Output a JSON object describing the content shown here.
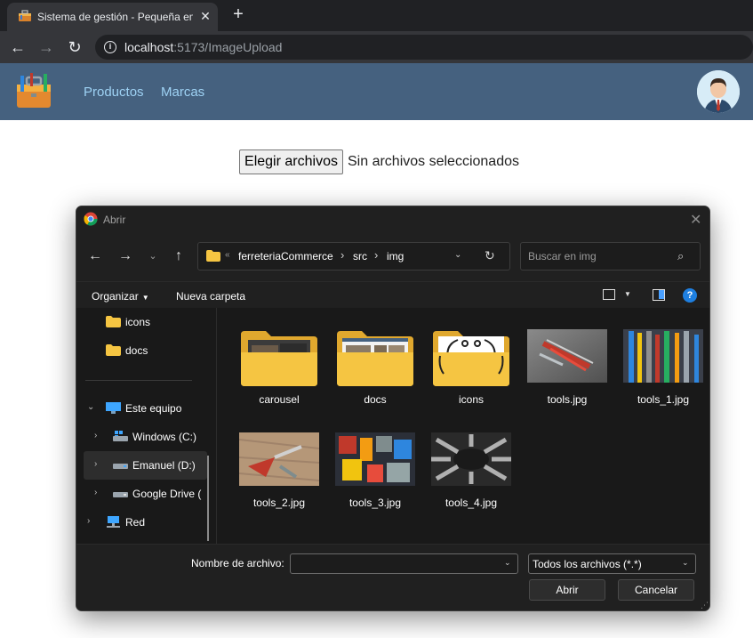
{
  "browser": {
    "tab_title": "Sistema de gestión - Pequeña empresa",
    "tab_close": "✕",
    "new_tab": "+",
    "url_host": "localhost",
    "url_path": ":5173/ImageUpload"
  },
  "app": {
    "nav": [
      {
        "label": "Productos"
      },
      {
        "label": "Marcas"
      }
    ]
  },
  "page": {
    "choose_button": "Elegir archivos",
    "no_files_text": "Sin archivos seleccionados"
  },
  "dialog": {
    "title": "Abrir",
    "close": "✕",
    "breadcrumb": [
      "ferreteriaCommerce",
      "src",
      "img"
    ],
    "breadcrumb_overflow": "«",
    "search_placeholder": "Buscar en img",
    "commands": {
      "organize": "Organizar",
      "new_folder": "Nueva carpeta"
    },
    "nav_pane": [
      {
        "label": "icons",
        "icon": "folder-icon"
      },
      {
        "label": "docs",
        "icon": "folder-icon"
      },
      {
        "label": "Este equipo",
        "icon": "computer-icon"
      },
      {
        "label": "Windows (C:)",
        "icon": "windows-drive-icon"
      },
      {
        "label": "Emanuel (D:)",
        "icon": "drive-icon"
      },
      {
        "label": "Google Drive (",
        "icon": "drive-icon"
      },
      {
        "label": "Red",
        "icon": "network-icon"
      }
    ],
    "files": [
      {
        "name": "carousel",
        "kind": "folder"
      },
      {
        "name": "docs",
        "kind": "folder"
      },
      {
        "name": "icons",
        "kind": "folder"
      },
      {
        "name": "tools.jpg",
        "kind": "image"
      },
      {
        "name": "tools_1.jpg",
        "kind": "image"
      },
      {
        "name": "tools_2.jpg",
        "kind": "image"
      },
      {
        "name": "tools_3.jpg",
        "kind": "image"
      },
      {
        "name": "tools_4.jpg",
        "kind": "image"
      }
    ],
    "filename_label": "Nombre de archivo:",
    "filename_value": "",
    "filetype_value": "Todos los archivos (*.*)",
    "open_button": "Abrir",
    "cancel_button": "Cancelar"
  },
  "colors": {
    "header_bg": "#45617f",
    "nav_link": "#9ed2f4",
    "dialog_bg": "#191919",
    "folder": "#f5c542"
  }
}
